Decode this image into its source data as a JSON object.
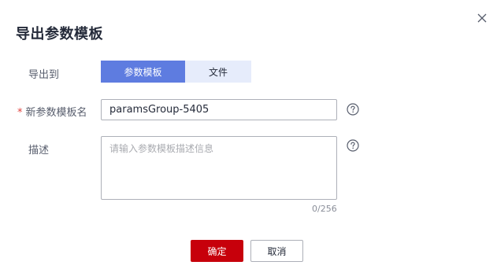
{
  "dialog": {
    "title": "导出参数模板",
    "close_icon": "close-icon"
  },
  "form": {
    "export_to": {
      "label": "导出到",
      "options": [
        "参数模板",
        "文件"
      ],
      "selected": "参数模板"
    },
    "template_name": {
      "required_mark": "*",
      "label": "新参数模板名",
      "value": "paramsGroup-5405",
      "help_icon": "question-circle-icon"
    },
    "description": {
      "label": "描述",
      "placeholder": "请输入参数模板描述信息",
      "value": "",
      "counter": "0/256",
      "help_icon": "question-circle-icon"
    }
  },
  "footer": {
    "ok_label": "确定",
    "cancel_label": "取消"
  },
  "colors": {
    "primary": "#5e7ce0",
    "danger": "#c7000b",
    "required": "#e0413d"
  }
}
